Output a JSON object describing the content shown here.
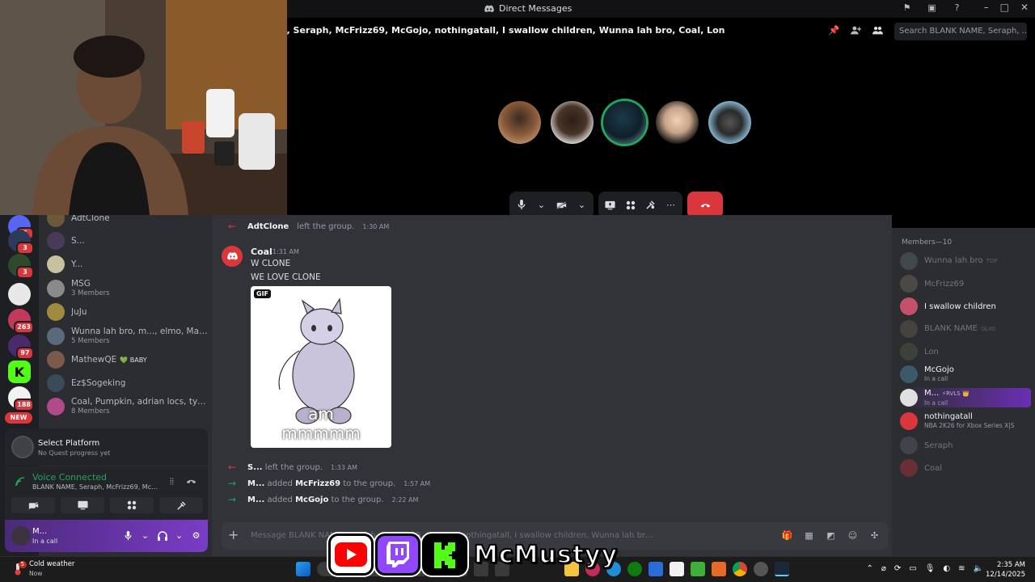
{
  "window": {
    "title": "Direct Messages"
  },
  "call": {
    "participants_title": "E, Seraph, McFrizz69, McGojo, nothingatall, I swallow children, Wunna lah bro, Coal, Lon",
    "search_placeholder": "Search BLANK NAME, Seraph, ...",
    "speaking_index": 2
  },
  "dms": [
    {
      "name": "AdtClone",
      "sub": ""
    },
    {
      "name": "S...",
      "sub": ""
    },
    {
      "name": "Y...",
      "sub": ""
    },
    {
      "name": "MSG",
      "sub": "3 Members"
    },
    {
      "name": "JuJu",
      "sub": ""
    },
    {
      "name": "Wunna lah bro, m..., elmo, Mathe...",
      "sub": "5 Members"
    },
    {
      "name": "MathewQE",
      "sub": "",
      "tag": "BABY"
    },
    {
      "name": "Ez$Sogeking",
      "sub": ""
    },
    {
      "name": "Coal, Pumpkin, adrian locs, tyell,...",
      "sub": "8 Members"
    }
  ],
  "servers": {
    "badges": [
      "5",
      "3",
      "3",
      "263",
      "97",
      "188"
    ],
    "new_label": "NEW"
  },
  "quest": {
    "title": "Select Platform",
    "subtitle": "No Quest progress yet"
  },
  "voice": {
    "status": "Voice Connected",
    "channel": "BLANK NAME, Seraph, McFrizz69, McGojo, ..."
  },
  "user": {
    "name": "M...",
    "status": "In a call"
  },
  "chat": {
    "top_event": {
      "name": "AdtClone",
      "text": "left the group.",
      "time": "1:30 AM"
    },
    "message": {
      "author": "Coal",
      "time": "1:31 AM",
      "lines": [
        "W CLONE",
        "WE LOVE CLONE"
      ],
      "gif_tag": "GIF",
      "gif_caption": [
        "am",
        "mmmmm"
      ]
    },
    "events": [
      {
        "name": "S...",
        "text": "left the group.",
        "target": "",
        "tail": "",
        "time": "1:33 AM",
        "kind": "leave"
      },
      {
        "name": "M...",
        "text": "added",
        "target": "McFrizz69",
        "tail": "to the group.",
        "time": "1:57 AM",
        "kind": "add"
      },
      {
        "name": "M...",
        "text": "added",
        "target": "McGojo",
        "tail": "to the group.",
        "time": "2:22 AM",
        "kind": "add"
      }
    ],
    "composer_placeholder": "Message BLANK NAME, Seraph, McFrizz69, McGojo, nothingatall, I swallow children, Wunna lah bro, Coal, Lon"
  },
  "members": {
    "header": "Members—10",
    "list": [
      {
        "name": "Wunna lah bro",
        "sub": "",
        "tag": "TOP",
        "offline": true
      },
      {
        "name": "McFrizz69",
        "sub": "",
        "tag": "",
        "offline": true
      },
      {
        "name": "I swallow children",
        "sub": "",
        "tag": "",
        "offline": false
      },
      {
        "name": "BLANK NAME",
        "sub": "",
        "tag": "GL40",
        "offline": true
      },
      {
        "name": "Lon",
        "sub": "",
        "tag": "",
        "offline": true
      },
      {
        "name": "McGojo",
        "sub": "In a call",
        "tag": "",
        "offline": false
      },
      {
        "name": "M...",
        "sub": "In a call",
        "tag": "RVLS",
        "offline": false
      },
      {
        "name": "nothingatall",
        "sub": "NBA 2K26 for Xbox Series X|S",
        "tag": "",
        "offline": false
      },
      {
        "name": "Seraph",
        "sub": "",
        "tag": "",
        "offline": true
      },
      {
        "name": "Coal",
        "sub": "",
        "tag": "",
        "offline": true
      }
    ]
  },
  "taskbar": {
    "weather_title": "Cold weather",
    "weather_sub": "Now",
    "weather_badge": "5",
    "time": "2:35 AM",
    "date": "12/14/2025"
  },
  "overlay": {
    "handle": "McMustyy"
  },
  "colors": {
    "accent_green": "#23a55a",
    "danger_red": "#da373c",
    "youtube": "#ff0000",
    "twitch": "#9146ff",
    "kick": "#53fc18"
  }
}
